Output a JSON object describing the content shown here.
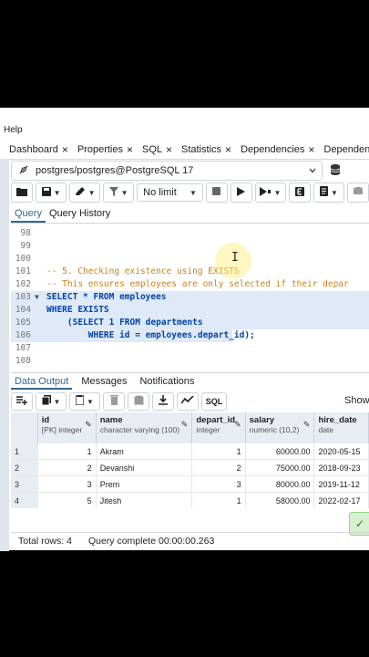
{
  "menu": {
    "help": "Help"
  },
  "tabs": [
    {
      "label": "Dashboard"
    },
    {
      "label": "Properties"
    },
    {
      "label": "SQL"
    },
    {
      "label": "Statistics"
    },
    {
      "label": "Dependencies"
    },
    {
      "label": "Dependents"
    }
  ],
  "tab_close": "×",
  "connection": {
    "label": "postgres/postgres@PostgreSQL 17"
  },
  "toolbar": {
    "limit": "No limit"
  },
  "query_tabs": {
    "query": "Query",
    "history": "Query History"
  },
  "editor": {
    "lines": [
      {
        "n": "98",
        "text": ""
      },
      {
        "n": "99",
        "text": ""
      },
      {
        "n": "100",
        "text": ""
      },
      {
        "n": "101",
        "text": "-- 5. Checking existence using EXISTS"
      },
      {
        "n": "102",
        "text": "-- This ensures employees are only selected if their depar"
      },
      {
        "n": "103",
        "text": "SELECT * FROM employees"
      },
      {
        "n": "104",
        "text": "WHERE EXISTS"
      },
      {
        "n": "105",
        "text": "    (SELECT 1 FROM departments"
      },
      {
        "n": "106",
        "text": "        WHERE id = employees.depart_id);"
      },
      {
        "n": "107",
        "text": ""
      },
      {
        "n": "108",
        "text": ""
      }
    ]
  },
  "output_tabs": {
    "data": "Data Output",
    "messages": "Messages",
    "notifications": "Notifications"
  },
  "output_toolbar": {
    "sql": "SQL",
    "showing": "Showi"
  },
  "grid": {
    "columns": [
      {
        "name": "id",
        "type": "[PK] integer"
      },
      {
        "name": "name",
        "type": "character varying (100)"
      },
      {
        "name": "depart_id",
        "type": "integer"
      },
      {
        "name": "salary",
        "type": "numeric (10,2)"
      },
      {
        "name": "hire_date",
        "type": "date"
      }
    ],
    "rows": [
      {
        "rn": "1",
        "id": "1",
        "name": "Akram",
        "depart_id": "1",
        "salary": "60000.00",
        "hire_date": "2020-05-15"
      },
      {
        "rn": "2",
        "id": "2",
        "name": "Devanshi",
        "depart_id": "2",
        "salary": "75000.00",
        "hire_date": "2018-09-23"
      },
      {
        "rn": "3",
        "id": "3",
        "name": "Prem",
        "depart_id": "3",
        "salary": "80000.00",
        "hire_date": "2019-11-12"
      },
      {
        "rn": "4",
        "id": "5",
        "name": "Jitesh",
        "depart_id": "1",
        "salary": "58000.00",
        "hire_date": "2022-02-17"
      }
    ]
  },
  "footer": {
    "total_rows": "Total rows: 4",
    "status": "Query complete 00:00:00.263"
  },
  "colors": {
    "accent": "#326690",
    "selection": "#dfe9f7",
    "comment": "#c88217",
    "keyword": "#0044aa"
  }
}
